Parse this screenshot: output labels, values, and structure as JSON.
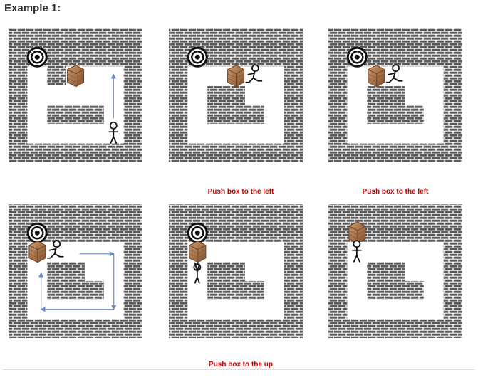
{
  "title": "Example 1:",
  "captions": {
    "panel_2": "Push box to the left",
    "panel_3": "Push box to the left",
    "panel_5": "Push box to the up"
  },
  "colors": {
    "wall": "#5b5b5b",
    "mortar": "#ffffff",
    "floor": "#ffffff",
    "box": "#b07a4a",
    "arrow": "#6a8cc0",
    "caption": "#c00000"
  },
  "grid": {
    "cols": 7,
    "rows": 7
  },
  "panels": [
    {
      "id": "panel-1",
      "floor": [
        [
          1,
          3
        ],
        [
          2,
          3
        ],
        [
          3,
          3
        ],
        [
          4,
          3
        ],
        [
          5,
          3
        ],
        [
          1,
          4
        ],
        [
          5,
          4
        ],
        [
          1,
          5
        ],
        [
          2,
          5
        ],
        [
          3,
          5
        ],
        [
          4,
          5
        ],
        [
          5,
          5
        ],
        [
          1,
          2
        ],
        [
          5,
          2
        ],
        [
          3,
          2
        ],
        [
          4,
          2
        ]
      ],
      "target": [
        1,
        1
      ],
      "box": [
        3,
        2
      ],
      "player": [
        5,
        5
      ],
      "player_pose": "standing",
      "icons": [
        "target-icon",
        "box-icon",
        "player-icon",
        "up-arrow"
      ]
    },
    {
      "id": "panel-2",
      "floor": [
        [
          1,
          2
        ],
        [
          2,
          2
        ],
        [
          3,
          2
        ],
        [
          4,
          2
        ],
        [
          5,
          2
        ],
        [
          1,
          3
        ],
        [
          1,
          4
        ],
        [
          1,
          5
        ],
        [
          2,
          5
        ],
        [
          3,
          5
        ],
        [
          4,
          5
        ],
        [
          5,
          5
        ],
        [
          5,
          3
        ],
        [
          5,
          4
        ],
        [
          4,
          3
        ]
      ],
      "target": [
        1,
        1
      ],
      "box": [
        3,
        2
      ],
      "player": [
        4,
        2
      ],
      "player_pose": "pushing",
      "icons": [
        "target-icon",
        "box-icon",
        "player-icon"
      ]
    },
    {
      "id": "panel-3",
      "floor": [
        [
          1,
          2
        ],
        [
          2,
          2
        ],
        [
          3,
          2
        ],
        [
          4,
          2
        ],
        [
          5,
          2
        ],
        [
          1,
          3
        ],
        [
          1,
          4
        ],
        [
          1,
          5
        ],
        [
          2,
          5
        ],
        [
          3,
          5
        ],
        [
          4,
          5
        ],
        [
          5,
          5
        ],
        [
          5,
          3
        ],
        [
          5,
          4
        ],
        [
          4,
          3
        ]
      ],
      "target": [
        1,
        1
      ],
      "box": [
        2,
        2
      ],
      "player": [
        3,
        2
      ],
      "player_pose": "pushing",
      "icons": [
        "target-icon",
        "box-icon",
        "player-icon"
      ]
    },
    {
      "id": "panel-4",
      "floor": [
        [
          1,
          2
        ],
        [
          2,
          2
        ],
        [
          3,
          2
        ],
        [
          4,
          2
        ],
        [
          5,
          2
        ],
        [
          1,
          3
        ],
        [
          1,
          4
        ],
        [
          1,
          5
        ],
        [
          2,
          5
        ],
        [
          3,
          5
        ],
        [
          4,
          5
        ],
        [
          5,
          5
        ],
        [
          5,
          3
        ],
        [
          5,
          4
        ],
        [
          4,
          3
        ]
      ],
      "target": [
        1,
        1
      ],
      "box": [
        1,
        2
      ],
      "player": [
        2,
        2
      ],
      "player_pose": "pushing",
      "icons": [
        "target-icon",
        "box-icon",
        "player-icon",
        "path-arrows"
      ]
    },
    {
      "id": "panel-5",
      "floor": [
        [
          1,
          2
        ],
        [
          1,
          3
        ],
        [
          1,
          4
        ],
        [
          1,
          5
        ],
        [
          2,
          5
        ],
        [
          3,
          5
        ],
        [
          4,
          5
        ],
        [
          5,
          5
        ],
        [
          5,
          3
        ],
        [
          5,
          4
        ],
        [
          5,
          2
        ],
        [
          2,
          2
        ],
        [
          3,
          2
        ],
        [
          4,
          2
        ],
        [
          4,
          3
        ]
      ],
      "target": [
        1,
        1
      ],
      "box": [
        1,
        2
      ],
      "player": [
        1,
        3
      ],
      "player_pose": "pushing-up",
      "icons": [
        "target-icon",
        "box-icon",
        "player-icon"
      ]
    },
    {
      "id": "panel-6",
      "floor": [
        [
          1,
          2
        ],
        [
          1,
          3
        ],
        [
          1,
          4
        ],
        [
          1,
          5
        ],
        [
          2,
          5
        ],
        [
          3,
          5
        ],
        [
          4,
          5
        ],
        [
          5,
          5
        ],
        [
          5,
          3
        ],
        [
          5,
          4
        ],
        [
          5,
          2
        ],
        [
          2,
          2
        ],
        [
          3,
          2
        ],
        [
          4,
          2
        ],
        [
          4,
          3
        ]
      ],
      "target": [
        1,
        1
      ],
      "box": [
        1,
        1
      ],
      "player": [
        1,
        2
      ],
      "player_pose": "standing",
      "icons": [
        "box-icon",
        "player-icon"
      ]
    }
  ]
}
